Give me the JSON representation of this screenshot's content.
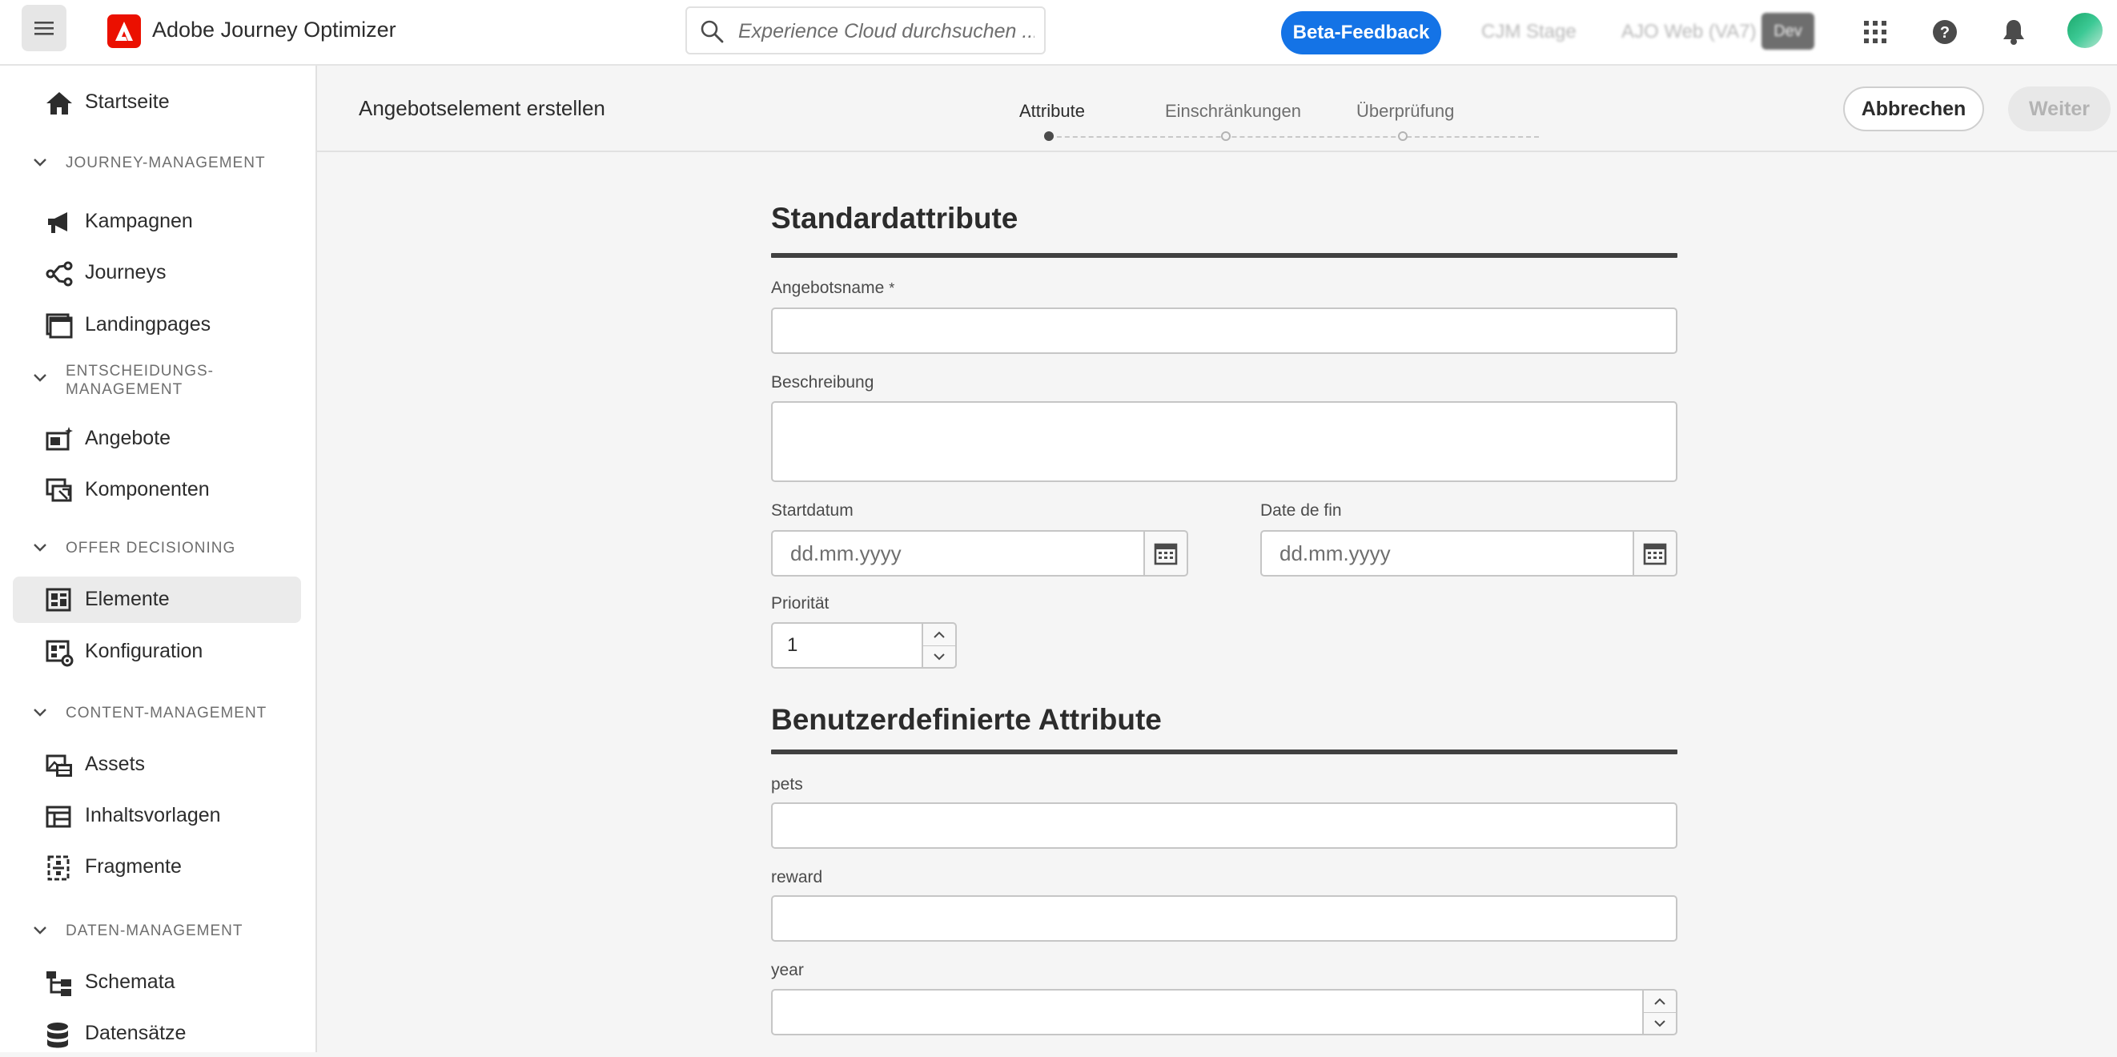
{
  "header": {
    "app_name": "Adobe Journey Optimizer",
    "search_placeholder": "Experience Cloud durchsuchen ...",
    "beta_feedback": "Beta-Feedback",
    "org_1": "CJM Stage",
    "org_2": "AJO Web (VA7)",
    "env_badge": "Dev",
    "brand_color": "#eb1000",
    "accent_color": "#1473e6"
  },
  "sidebar": {
    "home": "Startseite",
    "sections": {
      "journey": "JOURNEY-MANAGEMENT",
      "decision_1": "ENTSCHEIDUNGS-",
      "decision_2": "MANAGEMENT",
      "offer": "OFFER DECISIONING",
      "content": "CONTENT-MANAGEMENT",
      "data": "DATEN-MANAGEMENT"
    },
    "items": {
      "kampagnen": "Kampagnen",
      "journeys": "Journeys",
      "landingpages": "Landingpages",
      "angebote": "Angebote",
      "komponenten": "Komponenten",
      "elemente": "Elemente",
      "konfiguration": "Konfiguration",
      "assets": "Assets",
      "inhaltsvorlagen": "Inhaltsvorlagen",
      "fragmente": "Fragmente",
      "schemata": "Schemata",
      "datensaetze": "Datensätze"
    },
    "selected": "Elemente"
  },
  "page": {
    "title": "Angebotselement erstellen",
    "steps": [
      "Attribute",
      "Einschränkungen",
      "Überprüfung"
    ],
    "current_step": 1,
    "cancel": "Abbrechen",
    "next": "Weiter"
  },
  "form": {
    "standard_heading": "Standardattribute",
    "name_label": "Angebotsname",
    "name_required": "*",
    "name_value": "",
    "description_label": "Beschreibung",
    "description_value": "",
    "start_label": "Startdatum",
    "start_placeholder": "dd.mm.yyyy",
    "end_label": "Date de fin",
    "end_placeholder": "dd.mm.yyyy",
    "priority_label": "Priorität",
    "priority_value": "1",
    "custom_heading": "Benutzerdefinierte Attribute",
    "custom_fields": [
      {
        "label": "pets",
        "value": ""
      },
      {
        "label": "reward",
        "value": ""
      },
      {
        "label": "year",
        "value": ""
      }
    ]
  }
}
